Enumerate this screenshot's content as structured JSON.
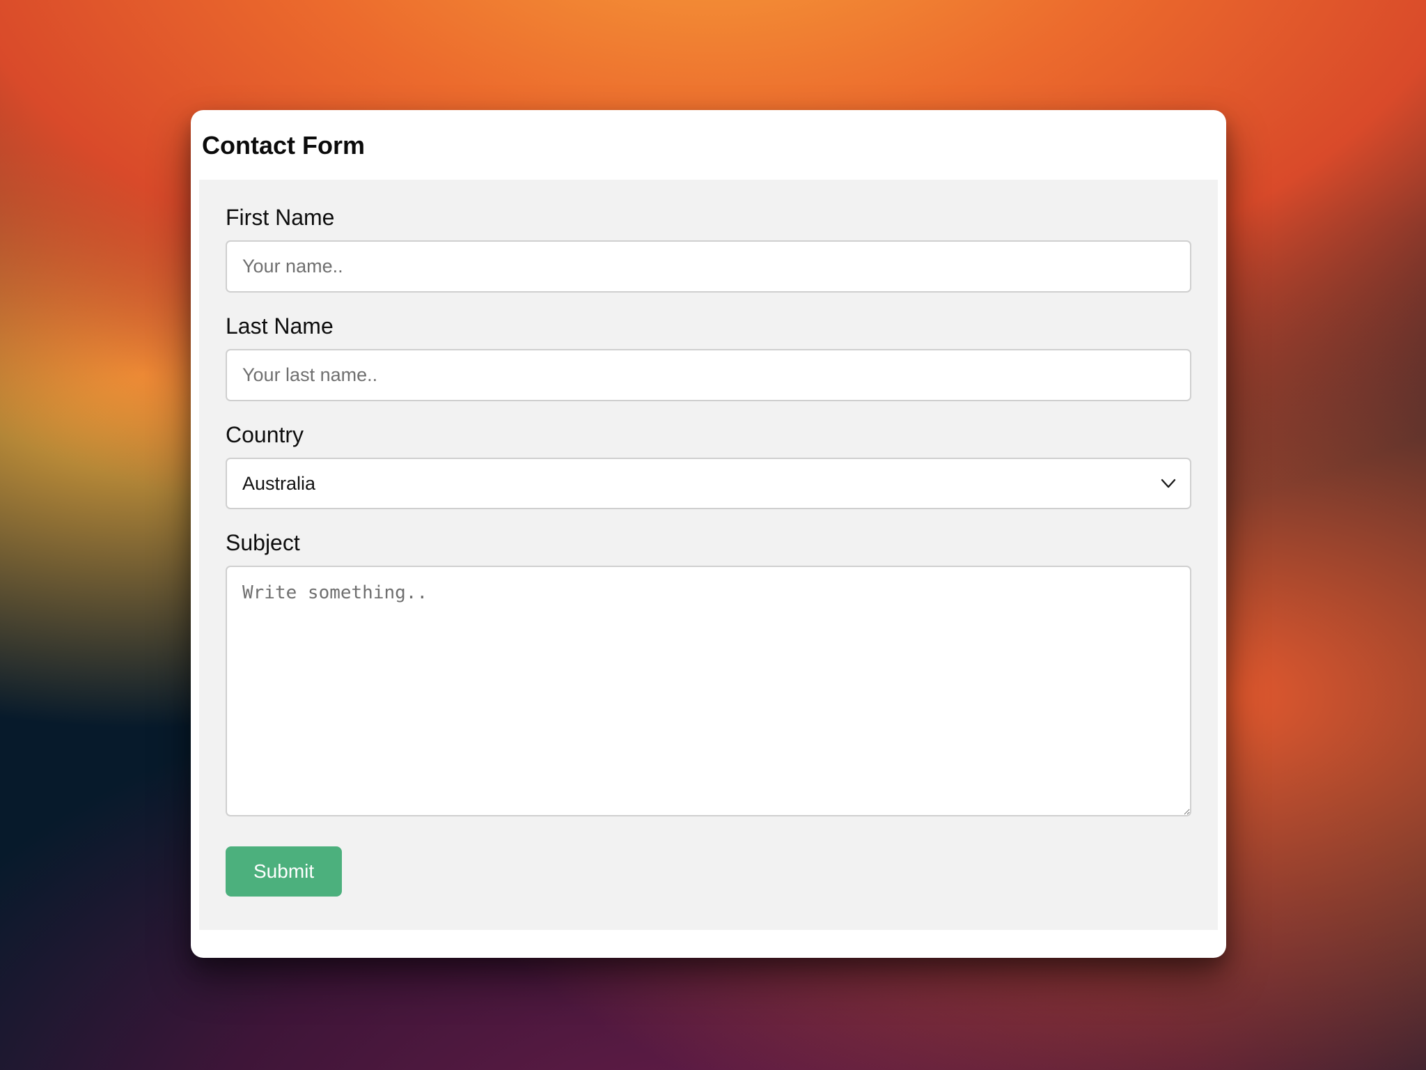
{
  "form": {
    "title": "Contact Form",
    "fields": {
      "first_name": {
        "label": "First Name",
        "placeholder": "Your name.."
      },
      "last_name": {
        "label": "Last Name",
        "placeholder": "Your last name.."
      },
      "country": {
        "label": "Country",
        "selected": "Australia"
      },
      "subject": {
        "label": "Subject",
        "placeholder": "Write something.."
      }
    },
    "submit_label": "Submit"
  },
  "colors": {
    "submit_bg": "#4cb07d",
    "form_bg": "#f2f2f2",
    "input_border": "#cfcfcf"
  }
}
